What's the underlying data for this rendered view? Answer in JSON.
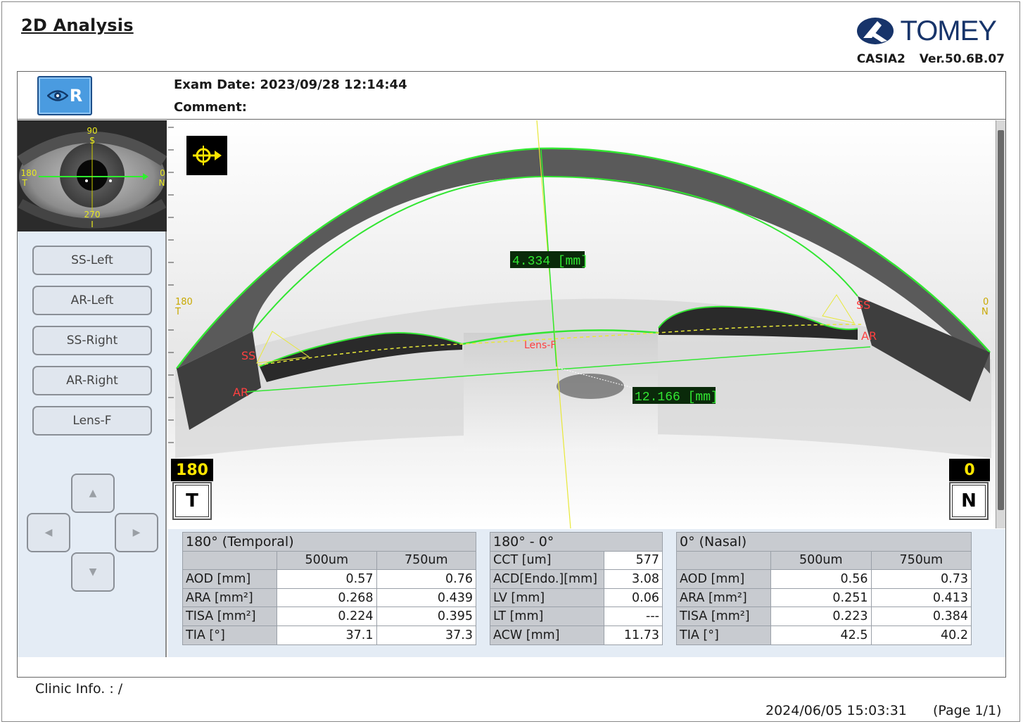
{
  "report": {
    "title": "2D Analysis"
  },
  "brand": {
    "name": "TOMEY",
    "device": "CASIA2",
    "version": "Ver.50.6B.07"
  },
  "exam": {
    "date": "Exam Date: 2023/09/28 12:14:44",
    "comment": "Comment:"
  },
  "eye": {
    "side": "R",
    "icon": "eye-icon"
  },
  "thumbnail": {
    "top": "90",
    "top_sub": "S",
    "left": "180",
    "left_sub": "T",
    "right": "0",
    "right_sub": "N",
    "bottom": "270",
    "bottom_sub": "I"
  },
  "side_buttons": [
    "SS-Left",
    "AR-Left",
    "SS-Right",
    "AR-Right",
    "Lens-F"
  ],
  "arrows": {
    "up": "up-arrow-icon",
    "left": "left-arrow-icon",
    "right": "right-arrow-icon",
    "down": "down-arrow-icon"
  },
  "scan": {
    "central_measure": "4.334 [mm]",
    "width_measure": "12.166 [mm]",
    "left_axis": "180",
    "left_axis_sub": "T",
    "right_axis": "0",
    "right_axis_sub": "N",
    "ss_label": "SS",
    "ar_label": "AR",
    "lens_label": "Lens-F",
    "left_degree": "180",
    "left_letter": "T",
    "right_degree": "0",
    "right_letter": "N",
    "colors": {
      "segmentation": "#32e632",
      "guide": "#e8e838",
      "marker": "#ff4040"
    }
  },
  "tables": {
    "temporal": {
      "title": "180° (Temporal)",
      "cols": [
        "500um",
        "750um"
      ],
      "rows": [
        {
          "label": "AOD [mm]",
          "v1": "0.57",
          "v2": "0.76"
        },
        {
          "label": "ARA [mm²]",
          "v1": "0.268",
          "v2": "0.439"
        },
        {
          "label": "TISA [mm²]",
          "v1": "0.224",
          "v2": "0.395"
        },
        {
          "label": "TIA [°]",
          "v1": "37.1",
          "v2": "37.3"
        }
      ]
    },
    "center": {
      "title": "180° - 0°",
      "rows": [
        {
          "label": "CCT [um]",
          "value": "577"
        },
        {
          "label": "ACD[Endo.][mm]",
          "value": "3.08"
        },
        {
          "label": "LV [mm]",
          "value": "0.06"
        },
        {
          "label": "LT [mm]",
          "value": "---"
        },
        {
          "label": "ACW [mm]",
          "value": "11.73"
        }
      ]
    },
    "nasal": {
      "title": "0° (Nasal)",
      "cols": [
        "500um",
        "750um"
      ],
      "rows": [
        {
          "label": "AOD [mm]",
          "v1": "0.56",
          "v2": "0.73"
        },
        {
          "label": "ARA [mm²]",
          "v1": "0.251",
          "v2": "0.413"
        },
        {
          "label": "TISA [mm²]",
          "v1": "0.223",
          "v2": "0.384"
        },
        {
          "label": "TIA [°]",
          "v1": "42.5",
          "v2": "40.2"
        }
      ]
    }
  },
  "footer": {
    "clinic": "Clinic Info. :    /",
    "printed": "2024/06/05 15:03:31",
    "page": "(Page 1/1)"
  }
}
